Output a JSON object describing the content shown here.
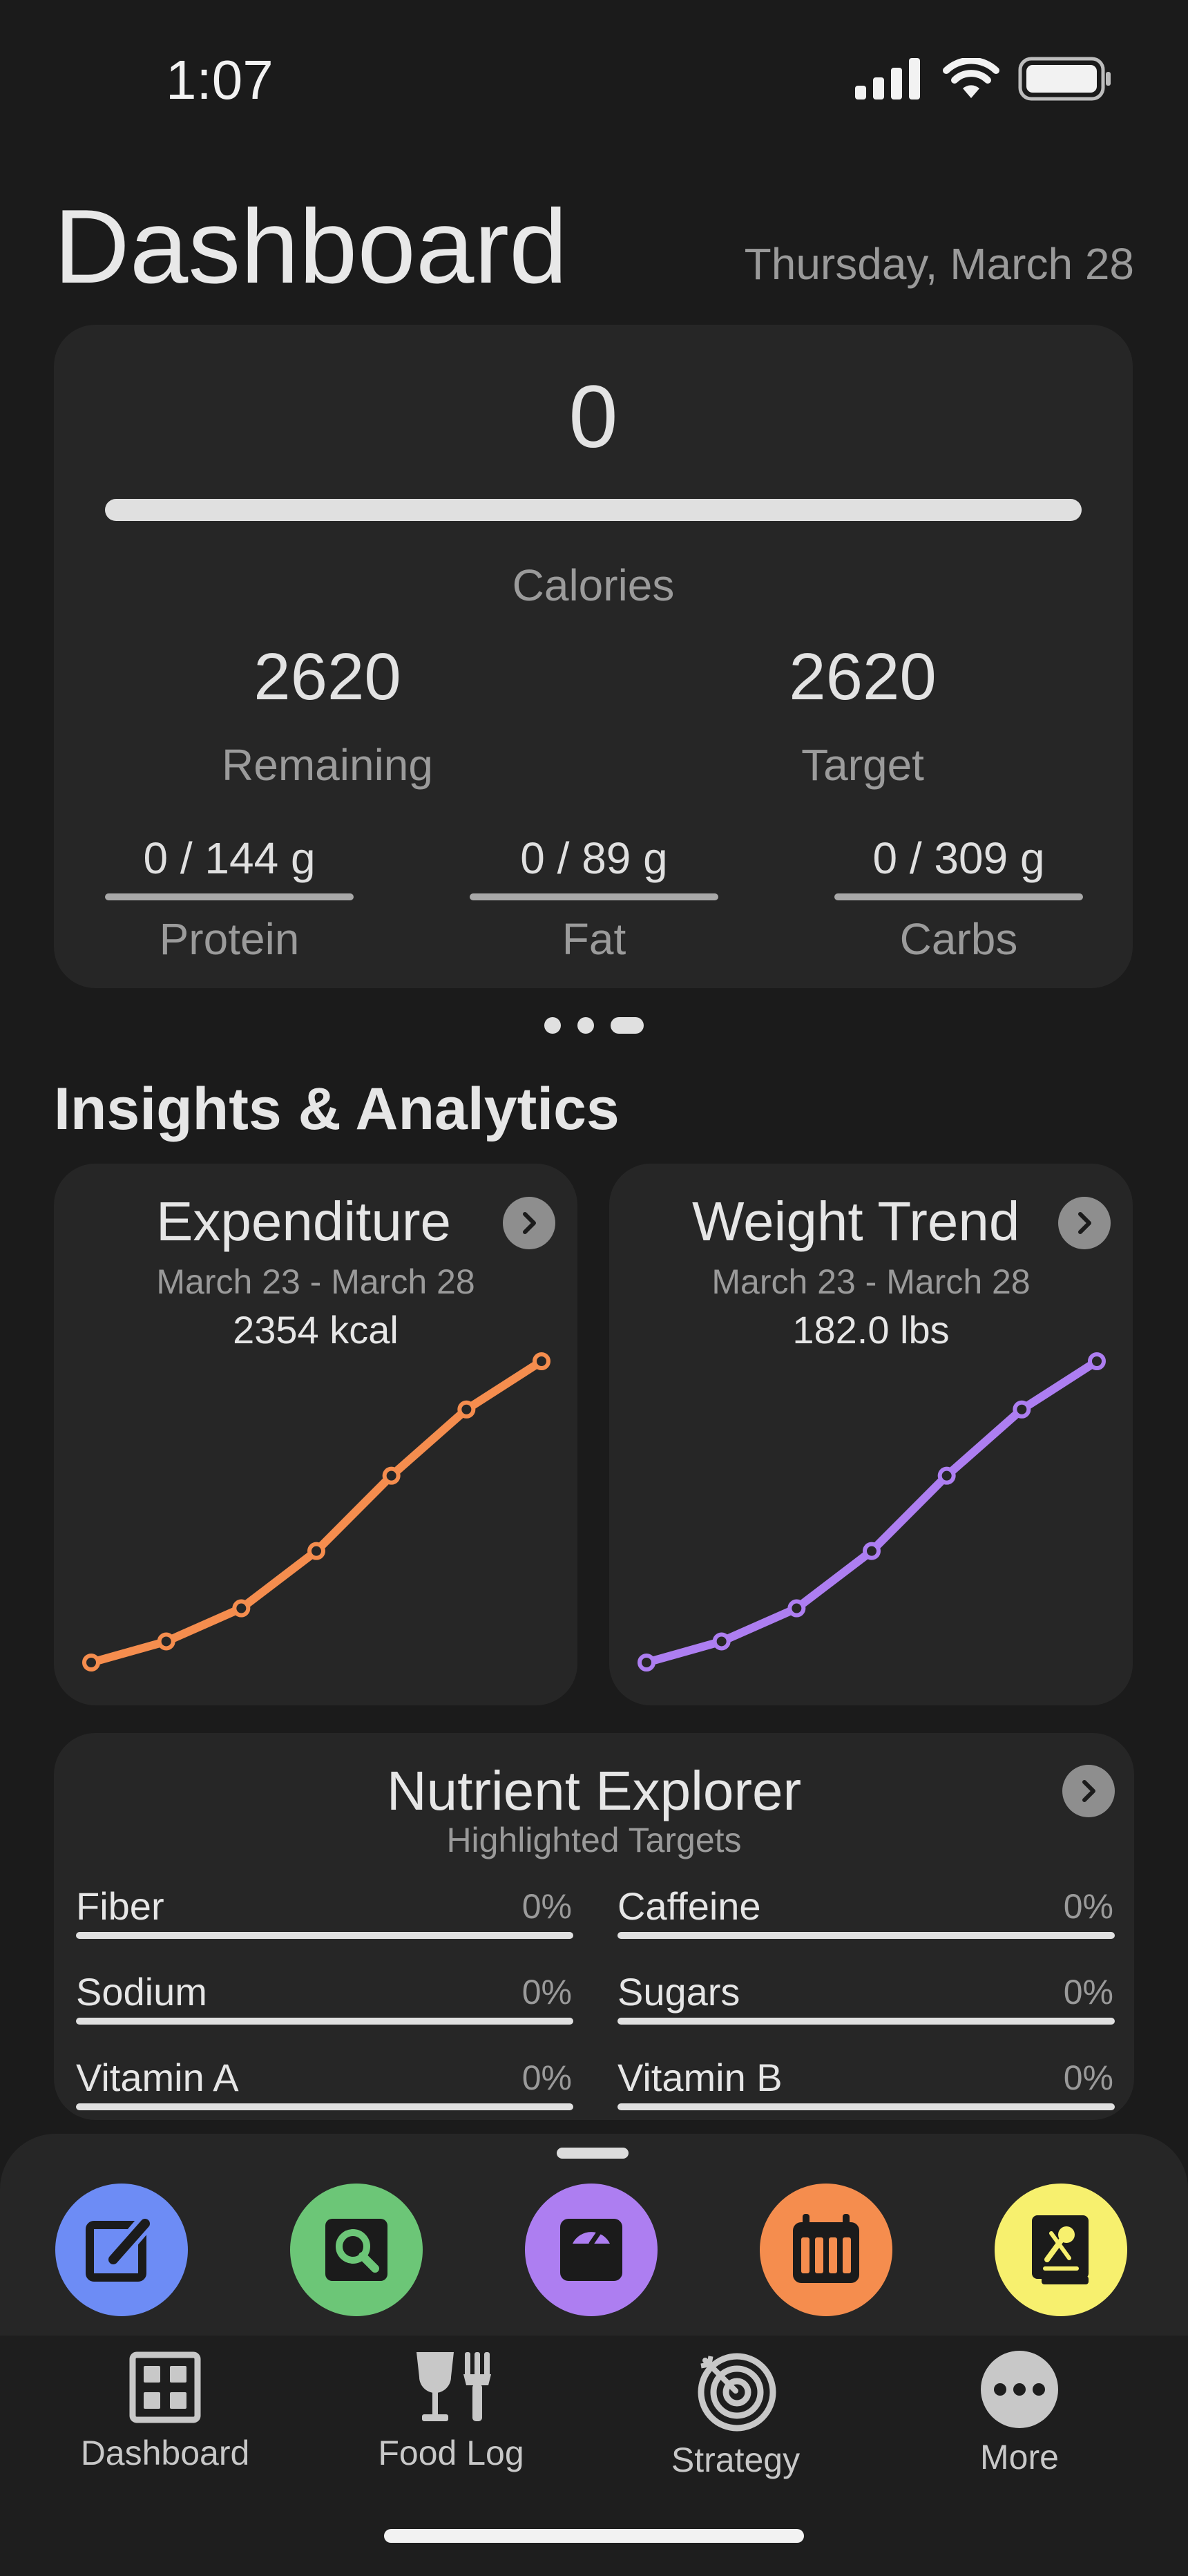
{
  "status_bar": {
    "time": "1:07"
  },
  "header": {
    "title": "Dashboard",
    "date": "Thursday, March 28"
  },
  "calories": {
    "consumed": "0",
    "label": "Calories",
    "progress_fraction": 0.0,
    "remaining_value": "2620",
    "remaining_label": "Remaining",
    "target_value": "2620",
    "target_label": "Target"
  },
  "macros": [
    {
      "value": "0 / 144 g",
      "label": "Protein"
    },
    {
      "value": "0 / 89 g",
      "label": "Fat"
    },
    {
      "value": "0 / 309 g",
      "label": "Carbs"
    }
  ],
  "pager": {
    "pages": 3,
    "active": 2
  },
  "insights": {
    "title": "Insights & Analytics",
    "expenditure": {
      "title": "Expenditure",
      "range": "March 23 - March 28",
      "value": "2354 kcal",
      "color": "#f58d4e"
    },
    "weight": {
      "title": "Weight Trend",
      "range": "March 23 - March 28",
      "value": "182.0 lbs",
      "color": "#ad7ef1"
    }
  },
  "chart_data": [
    {
      "type": "line",
      "series": [
        {
          "values": [
            0,
            0.07,
            0.18,
            0.37,
            0.62,
            0.84,
            1.0
          ]
        }
      ]
    },
    {
      "type": "line",
      "series": [
        {
          "values": [
            0,
            0.07,
            0.18,
            0.37,
            0.62,
            0.84,
            1.0
          ]
        }
      ]
    }
  ],
  "nutrients": {
    "title": "Nutrient Explorer",
    "subtitle": "Highlighted Targets",
    "items": [
      {
        "name": "Fiber",
        "pct": "0%"
      },
      {
        "name": "Caffeine",
        "pct": "0%"
      },
      {
        "name": "Sodium",
        "pct": "0%"
      },
      {
        "name": "Sugars",
        "pct": "0%"
      },
      {
        "name": "Vitamin A",
        "pct": "0%"
      },
      {
        "name": "Vitamin B",
        "pct": "0%"
      }
    ]
  },
  "quick_actions": [
    {
      "icon": "edit-icon",
      "color": "#6d8cf5"
    },
    {
      "icon": "search-food-icon",
      "color": "#6cc677"
    },
    {
      "icon": "scale-icon",
      "color": "#ad7ef1"
    },
    {
      "icon": "calendar-icon",
      "color": "#f58d4e"
    },
    {
      "icon": "recipe-book-icon",
      "color": "#f7f06e"
    }
  ],
  "tabs": [
    {
      "label": "Dashboard",
      "icon": "grid-icon"
    },
    {
      "label": "Food Log",
      "icon": "wine-fork-icon"
    },
    {
      "label": "Strategy",
      "icon": "target-icon"
    },
    {
      "label": "More",
      "icon": "more-icon"
    }
  ]
}
